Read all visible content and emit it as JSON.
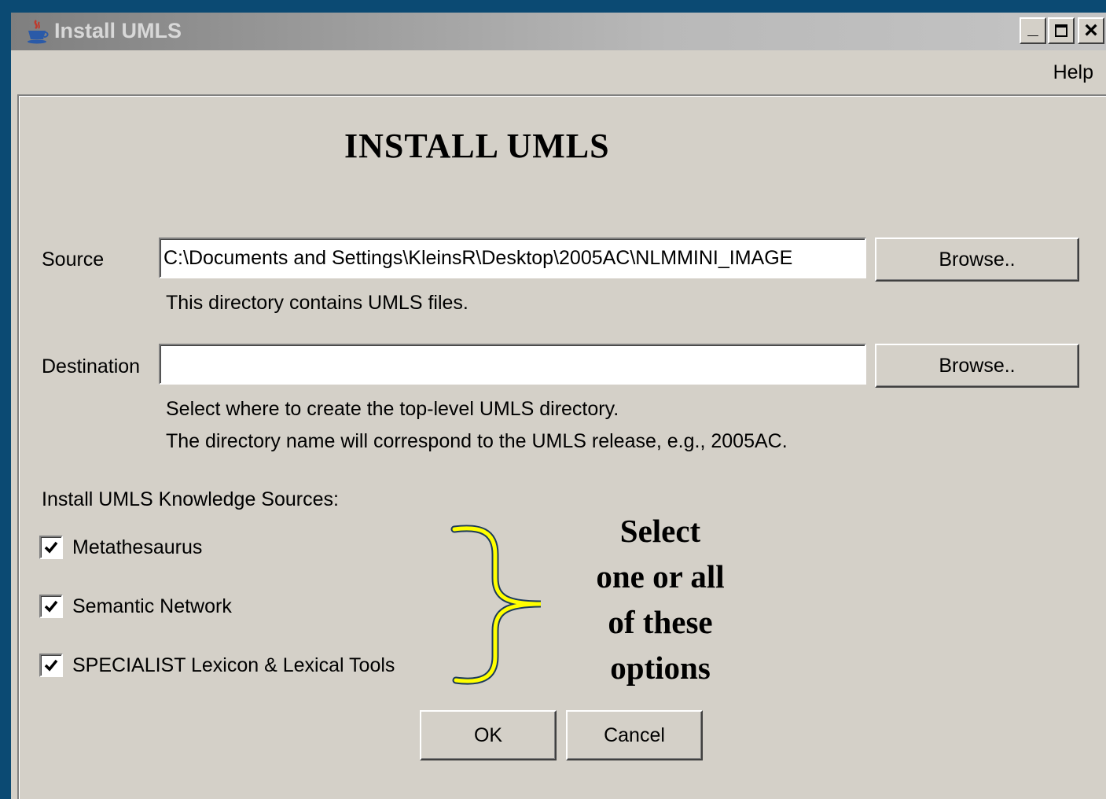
{
  "window": {
    "title": "Install UMLS",
    "controls": {
      "minimize": "_",
      "maximize": "□",
      "close": "×"
    }
  },
  "menubar": {
    "help": "Help"
  },
  "dialog": {
    "heading": "INSTALL UMLS",
    "source": {
      "label": "Source",
      "value": "C:\\Documents and Settings\\KleinsR\\Desktop\\2005AC\\NLMMINI_IMAGE",
      "hint": "This directory contains UMLS files.",
      "browse": "Browse.."
    },
    "destination": {
      "label": "Destination",
      "value": "",
      "hint1": "Select where to create the top-level UMLS directory.",
      "hint2": "The directory name will correspond to the UMLS release, e.g.,  2005AC.",
      "browse": "Browse.."
    },
    "knowledge_sources_label": "Install UMLS Knowledge Sources:",
    "options": [
      {
        "label": "Metathesaurus",
        "checked": true
      },
      {
        "label": "Semantic Network",
        "checked": true
      },
      {
        "label": "SPECIALIST Lexicon & Lexical Tools",
        "checked": true
      }
    ],
    "ok": "OK",
    "cancel": "Cancel"
  },
  "annotation": {
    "line1": "Select",
    "line2": "one or all",
    "line3": "of these",
    "line4": "options",
    "brace_color": "#ffff00"
  }
}
